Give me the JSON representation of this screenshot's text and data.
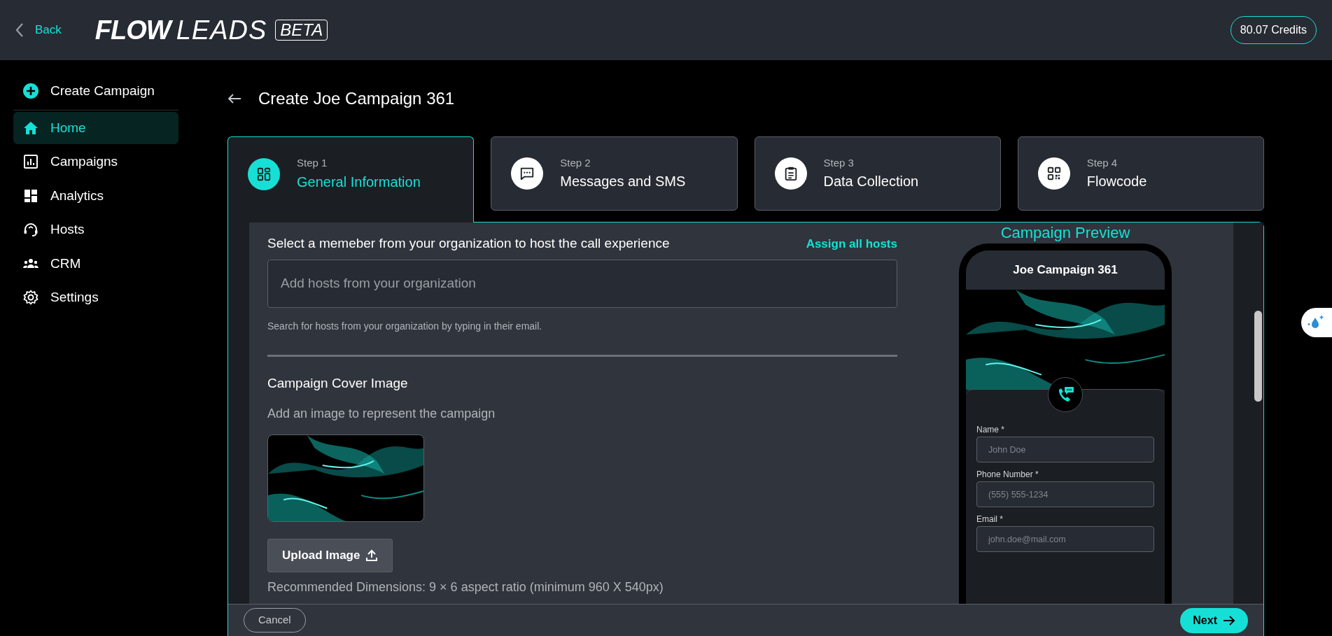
{
  "header": {
    "back": "Back",
    "logo": {
      "word_1": "FLOW",
      "word_2": "LEADS",
      "badge": "BETA"
    },
    "credits": "80.07 Credits"
  },
  "sidebar": {
    "create": "Create Campaign",
    "items": [
      {
        "label": "Home",
        "selected": true
      },
      {
        "label": "Campaigns",
        "selected": false
      },
      {
        "label": "Analytics",
        "selected": false
      },
      {
        "label": "Hosts",
        "selected": false
      },
      {
        "label": "CRM",
        "selected": false
      },
      {
        "label": "Settings",
        "selected": false
      }
    ]
  },
  "page_title": "Create Joe Campaign 361",
  "steps": [
    {
      "step": "Step 1",
      "title": "General Information",
      "selected": true
    },
    {
      "step": "Step 2",
      "title": "Messages and SMS",
      "selected": false
    },
    {
      "step": "Step 3",
      "title": "Data Collection",
      "selected": false
    },
    {
      "step": "Step 4",
      "title": "Flowcode",
      "selected": false
    }
  ],
  "hosts": {
    "label": "Select a memeber from your organization to host the call experience",
    "assign_link": "Assign all hosts",
    "placeholder": "Add hosts from your organization",
    "help": "Search for hosts from your organization by typing in their email."
  },
  "cover": {
    "title": "Campaign Cover Image",
    "subtitle": "Add an image to represent the campaign",
    "upload": "Upload Image",
    "note": "Recommended Dimensions: 9 × 6 aspect ratio (minimum 960 X 540px)"
  },
  "preview": {
    "heading": "Campaign Preview",
    "title": "Joe Campaign 361",
    "fields": [
      {
        "label": "Name *",
        "placeholder": "John Doe"
      },
      {
        "label": "Phone Number *",
        "placeholder": "(555) 555-1234"
      },
      {
        "label": "Email *",
        "placeholder": "john.doe@mail.com"
      }
    ]
  },
  "footer": {
    "cancel": "Cancel",
    "next": "Next"
  }
}
